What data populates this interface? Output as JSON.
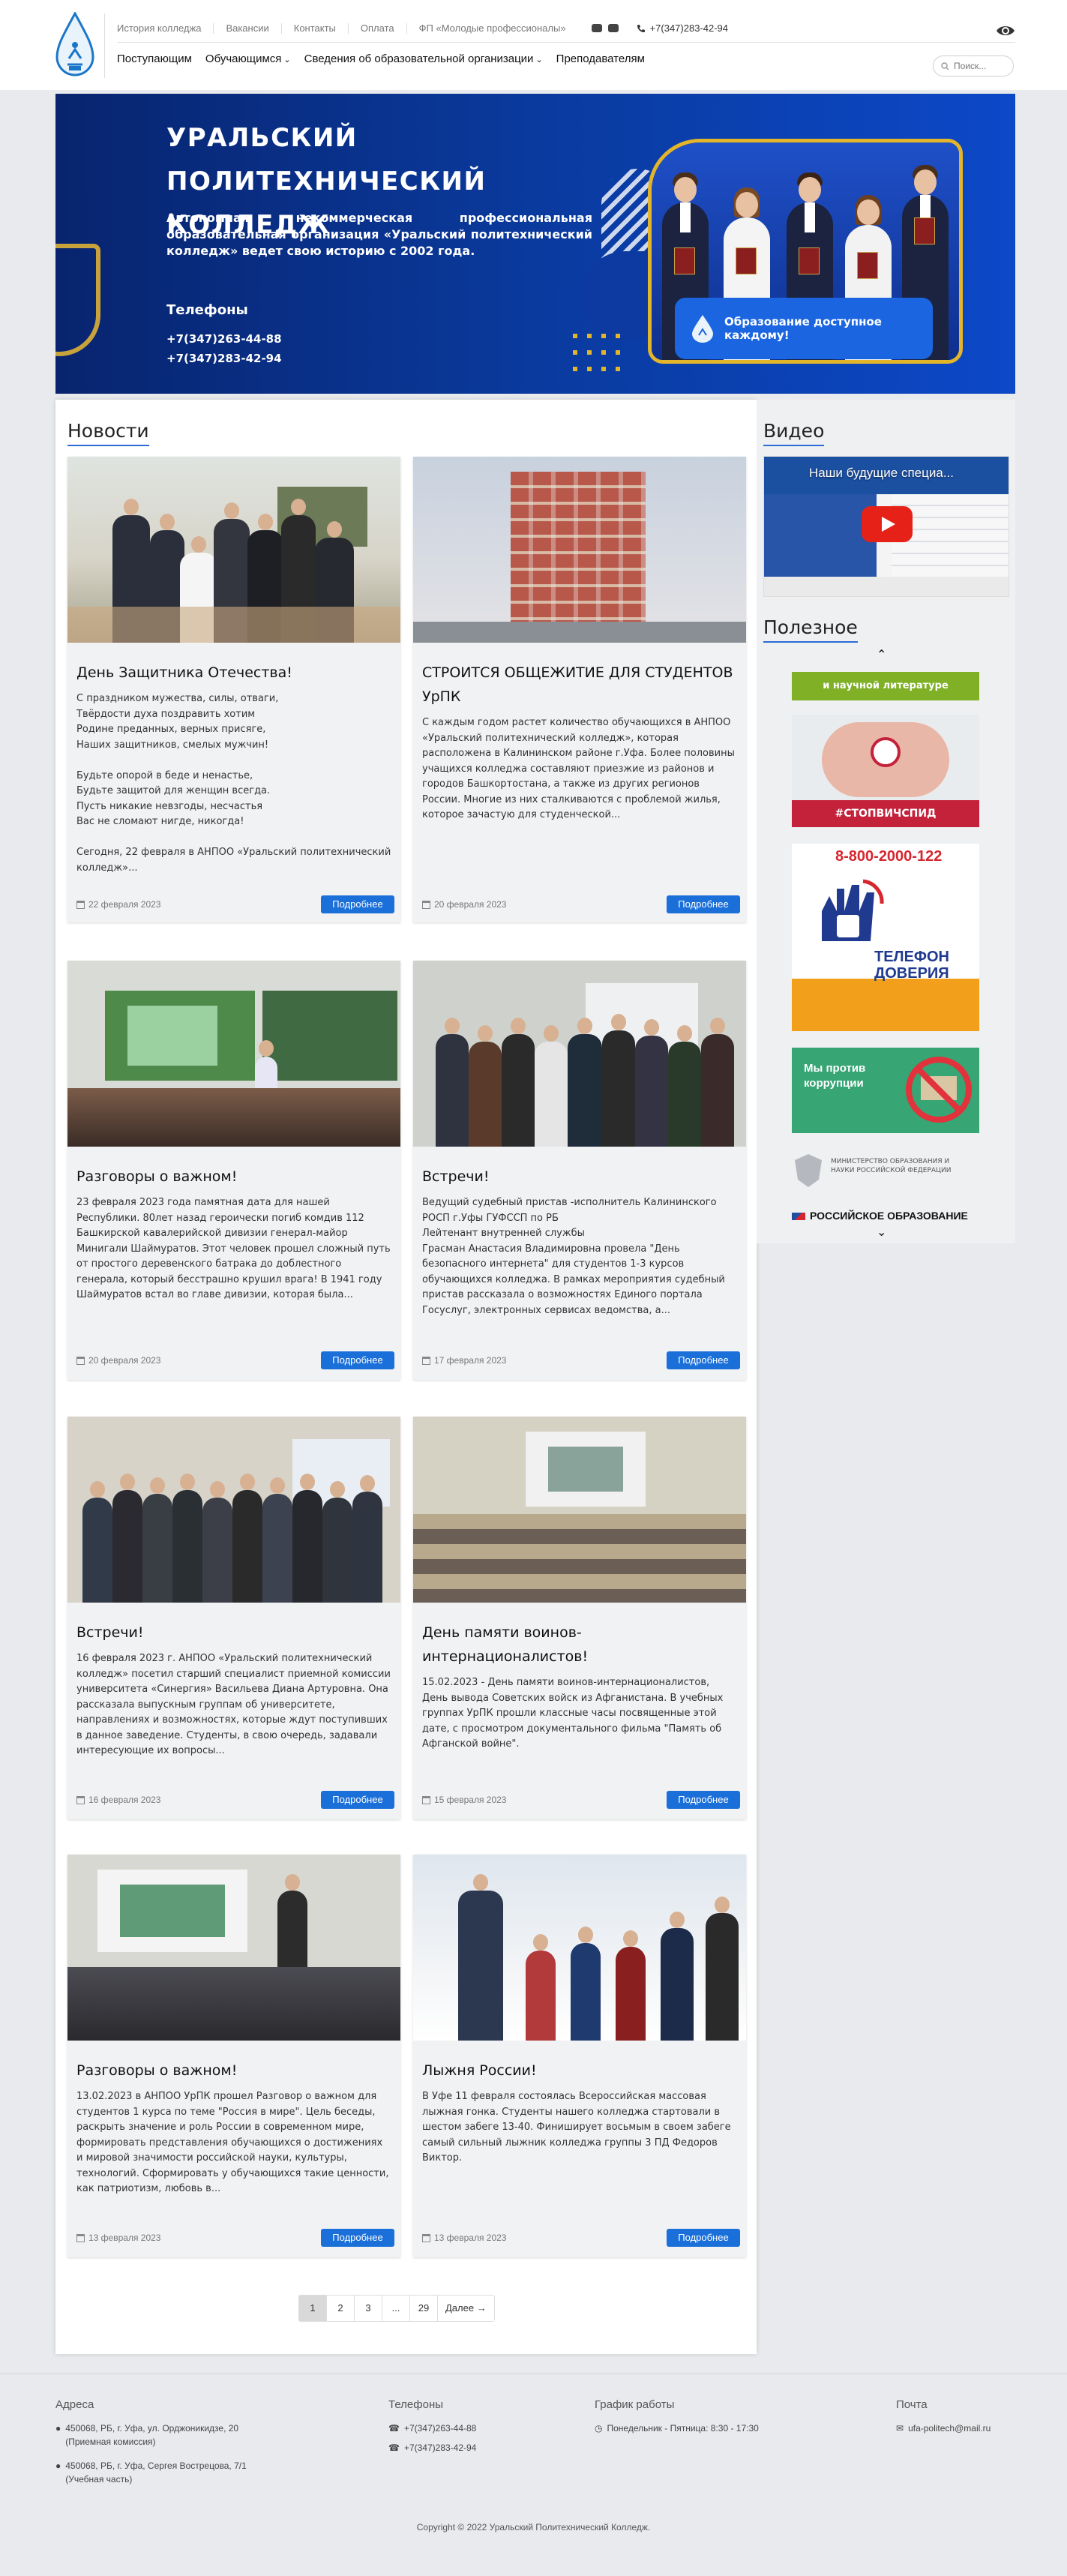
{
  "header": {
    "topnav": [
      "История колледжа",
      "Вакансии",
      "Контакты",
      "Оплата",
      "ФП «Молодые профессионалы»"
    ],
    "phone": "+7(347)283-42-94",
    "mainnav": [
      "Поступающим",
      "Обучающимся",
      "Сведения об образовательной организации",
      "Преподавателям"
    ],
    "search_placeholder": "Поиск..."
  },
  "banner": {
    "title": "УРАЛЬСКИЙ ПОЛИТЕХНИЧЕСКИЙ КОЛЛЕДЖ",
    "description": "Автономная некоммерческая профессиональная образовательная организация «Уральский политехнический колледж» ведет свою историю с 2002 года.",
    "phones_title": "Телефоны",
    "phone1": "+7(347)263-44-88",
    "phone2": "+7(347)283-42-94",
    "badge": "Образование доступное каждому!"
  },
  "news": {
    "title": "Новости",
    "more_label": "Подробнее",
    "items": [
      {
        "title": "День Защитника Отечества!",
        "text": "С праздником мужества, силы, отваги,\nТвёрдости духа поздравить хотим\nРодине преданных, верных присяге,\nНаших защитников, смелых мужчин!\n\nБудьте опорой в беде и ненастье,\nБудьте защитой для женщин всегда.\nПусть никакие невзгоды, несчастья\nВас не сломают нигде, никогда!\n\nСегодня, 22 февраля в АНПОО «Уральский политехнический колледж»...",
        "date": "22 февраля 2023"
      },
      {
        "title": "СТРОИТСЯ ОБЩЕЖИТИЕ ДЛЯ СТУДЕНТОВ УрПК",
        "text": "С каждым годом растет количество обучающихся в АНПОО «Уральский политехнический колледж», которая расположена в Калининском районе г.Уфа.  Более половины учащихся колледжа  составляют приезжие из районов и городов Башкортостана, а также из других регионов России.  Многие из них сталкиваются с проблемой жилья, которое зачастую для студенческой...",
        "date": "20 февраля 2023"
      },
      {
        "title": "Разговоры о важном!",
        "text": "23 февраля 2023 года памятная дата для нашей Республики. 80лет назад героически погиб комдив 112 Башкирской кавалерийской дивизии генерал-майор Минигали Шаймуратов. Этот человек прошел сложный путь от простого деревенского батрака до доблестного генерала, который бесстрашно крушил врага! В 1941 году Шаймуратов встал во главе дивизии, которая была...",
        "date": "20 февраля 2023"
      },
      {
        "title": "Встречи!",
        "text": "Ведущий судебный пристав -исполнитель Калининского РОСП г.Уфы ГУФССП по РБ\nЛейтенант внутренней службы\nГрасман Анастасия Владимировна провела \"День безопасного интернета\" для студентов 1-3 курсов обучающихся колледжа. В рамках мероприятия судебный пристав рассказала о возможностях Единого портала Госуслуг, электронных сервисах ведомства, а...",
        "date": "17 февраля 2023"
      },
      {
        "title": "Встречи!",
        "text": "16 февраля 2023 г. АНПОО «Уральский политехнический колледж»  посетил старший специалист приемной комиссии университета «Синергия» Васильева Диана Артуровна. Она рассказала выпускным группам об университете, направлениях и возможностях, которые ждут поступивших в данное заведение. Студенты, в свою очередь, задавали интересующие их вопросы...",
        "date": "16 февраля 2023"
      },
      {
        "title": "День памяти воинов-интернационалистов!",
        "text": "15.02.2023 - День памяти воинов-интернационалистов, День вывода Советских войск из Афганистана. В учебных группах УрПК прошли классные часы посвященные этой дате, с просмотром документального фильма \"Память об Афганской войне\".",
        "date": "15 февраля 2023"
      },
      {
        "title": "Разговоры о важном!",
        "text": "13.02.2023 в АНПОО УрПК прошел Разговор о важном для студентов 1 курса по теме \"Россия в мире\". Цель беседы, раскрыть значение и роль России в современном мире, формировать представления обучающихся о достижениях и мировой значимости российской науки, культуры, технологий. Сформировать у обучающихся такие ценности, как патриотизм, любовь в...",
        "date": "13 февраля 2023"
      },
      {
        "title": "Лыжня России!",
        "text": "В Уфе 11 февраля состоялась Всероссийская массовая лыжная гонка. Студенты нашего колледжа стартовали в шестом забеге 13-40. Финиширует восьмым в своем забеге самый сильный лыжник колледжа группы 3 ПД Федоров Виктор.",
        "date": "13 февраля 2023"
      }
    ]
  },
  "sidebar": {
    "video_title": "Видео",
    "video_caption": "Наши будущие специа...",
    "useful_title": "Полезное",
    "useful_items": [
      {
        "text": "и научной литературе"
      },
      {
        "text": "#СТОПВИЧСПИД"
      },
      {
        "text": "ТЕЛЕФОН ДОВЕРИЯ",
        "sub": "8-800-2000-122"
      },
      {
        "text": "Мы против коррупции"
      },
      {
        "text": "МИНИСТЕРСТВО ОБРАЗОВАНИЯ И НАУКИ РОССИЙСКОЙ ФЕДЕРАЦИИ"
      },
      {
        "text": "РОССИЙСКОЕ ОБРАЗОВАНИЕ"
      }
    ]
  },
  "pagination": [
    "1",
    "2",
    "3",
    "...",
    "29",
    "Далее →"
  ],
  "footer": {
    "address_title": "Адреса",
    "address1": "450068, РБ, г. Уфа, ул. Орджоникидзе, 20",
    "address1_note": "(Приемная комиссия)",
    "address2": "450068, РБ, г. Уфа, Сергея Вострецова, 7/1",
    "address2_note": "(Учебная часть)",
    "phones_title": "Телефоны",
    "phone1": "+7(347)263-44-88",
    "phone2": "+7(347)283-42-94",
    "schedule_title": "График работы",
    "schedule": "Понедельник - Пятница: 8:30 - 17:30",
    "mail_title": "Почта",
    "mail": "ufa-politech@mail.ru",
    "copyright": "Copyright © 2022 Уральский Политехнический Колледж."
  }
}
